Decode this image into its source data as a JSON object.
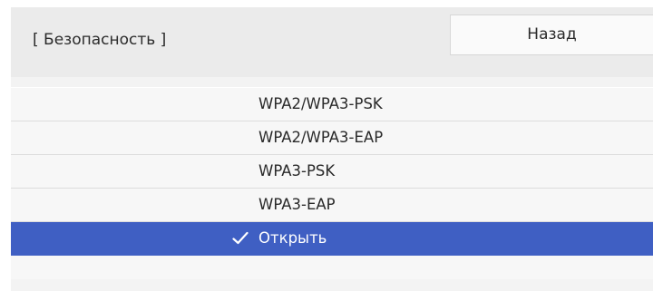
{
  "header": {
    "title": "[ Безопасность ]",
    "back_label": "Назад"
  },
  "options": [
    {
      "label": "WPA2/WPA3-PSK",
      "selected": false
    },
    {
      "label": "WPA2/WPA3-EAP",
      "selected": false
    },
    {
      "label": "WPA3-PSK",
      "selected": false
    },
    {
      "label": "WPA3-EAP",
      "selected": false
    },
    {
      "label": "Открыть",
      "selected": true,
      "icon": "check-icon"
    }
  ],
  "colors": {
    "header_bg": "#ebebeb",
    "list_bg": "#f7f7f7",
    "selected_bg": "#3f5fc3",
    "selected_text": "#ffffff",
    "text": "#2a2a2a"
  }
}
